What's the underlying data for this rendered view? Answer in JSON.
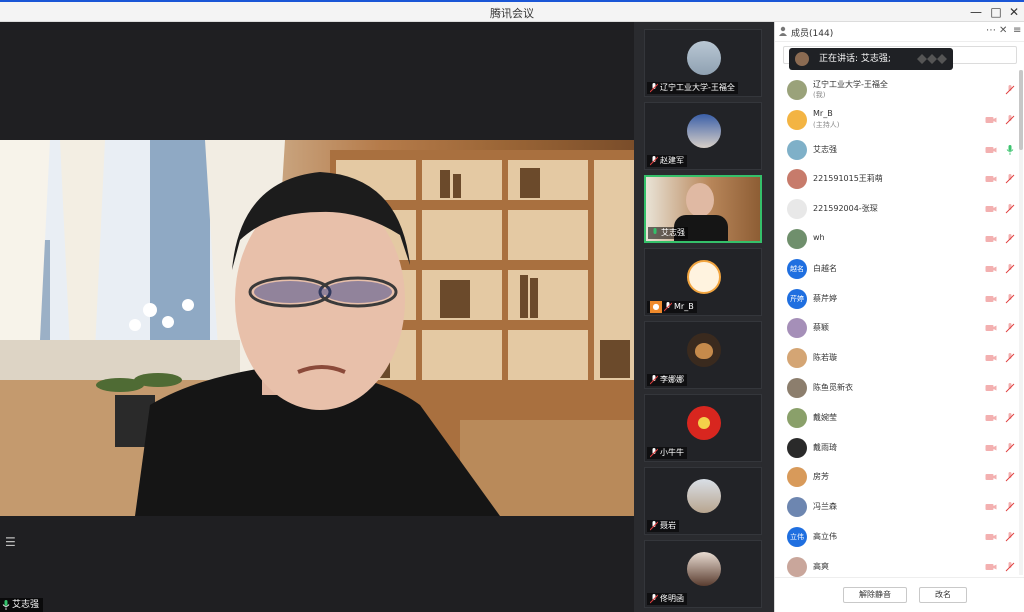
{
  "window": {
    "title": "腾讯会议"
  },
  "main_video": {
    "speaker": "艾志强"
  },
  "participants_strip": [
    {
      "name": "辽宁工业大学-王福全",
      "avatar": "landscape-avatar"
    },
    {
      "name": "赵建军",
      "avatar": "photo-avatar"
    },
    {
      "name": "艾志强",
      "avatar": "video-feed",
      "active": true
    },
    {
      "name": "Mr_B",
      "avatar": "tiger-avatar",
      "host": true
    },
    {
      "name": "李娜娜",
      "avatar": "dog-avatar"
    },
    {
      "name": "小牛牛",
      "avatar": "red-card-avatar"
    },
    {
      "name": "聂岩",
      "avatar": "photo-avatar"
    },
    {
      "name": "佟明函",
      "avatar": "photo-avatar"
    }
  ],
  "members_panel": {
    "title": "成员(144)",
    "now_speaking": "正在讲话: 艾志强;",
    "members": [
      {
        "name": "辽宁工业大学-王福全",
        "sub": "(我)",
        "avatar_color": "#9aa27a",
        "mic": "muted",
        "cam": "none"
      },
      {
        "name": "Mr_B",
        "sub": "(主持人)",
        "avatar_color": "#f3b443",
        "mic": "muted",
        "cam": "off"
      },
      {
        "name": "艾志强",
        "sub": "",
        "avatar_color": "#7fb0c8",
        "mic": "on",
        "cam": "off"
      },
      {
        "name": "221591015王莉萌",
        "sub": "",
        "avatar_color": "#c77b6b",
        "mic": "muted",
        "cam": "off"
      },
      {
        "name": "221592004-张琛",
        "sub": "",
        "avatar_color": "#e8e8e8",
        "mic": "muted",
        "cam": "off"
      },
      {
        "name": "wh",
        "sub": "",
        "avatar_color": "#6f8f6c",
        "mic": "muted",
        "cam": "off"
      },
      {
        "name": "白越名",
        "sub": "",
        "avatar_text": "越名",
        "mic": "muted",
        "cam": "off"
      },
      {
        "name": "蔡芹婷",
        "sub": "",
        "avatar_text": "芹婷",
        "mic": "muted",
        "cam": "off"
      },
      {
        "name": "蔡颖",
        "sub": "",
        "avatar_color": "#a58fb8",
        "mic": "muted",
        "cam": "off"
      },
      {
        "name": "陈若璇",
        "sub": "",
        "avatar_color": "#d4a574",
        "mic": "muted",
        "cam": "off"
      },
      {
        "name": "陈鱼觅新衣",
        "sub": "",
        "avatar_color": "#8c7e6d",
        "mic": "muted",
        "cam": "off"
      },
      {
        "name": "戴婉莹",
        "sub": "",
        "avatar_color": "#8aa06a",
        "mic": "muted",
        "cam": "off"
      },
      {
        "name": "戴雨琦",
        "sub": "",
        "avatar_color": "#2a2a2a",
        "mic": "muted",
        "cam": "off"
      },
      {
        "name": "房芳",
        "sub": "",
        "avatar_color": "#d89a5a",
        "mic": "muted",
        "cam": "off"
      },
      {
        "name": "冯兰森",
        "sub": "",
        "avatar_color": "#6d86b0",
        "mic": "muted",
        "cam": "off"
      },
      {
        "name": "高立伟",
        "sub": "",
        "avatar_text": "立伟",
        "mic": "muted",
        "cam": "off"
      },
      {
        "name": "高爽",
        "sub": "",
        "avatar_color": "#c9a69b",
        "mic": "muted",
        "cam": "off"
      }
    ],
    "buttons": {
      "unmute_all": "解除静音",
      "rename": "改名"
    }
  }
}
